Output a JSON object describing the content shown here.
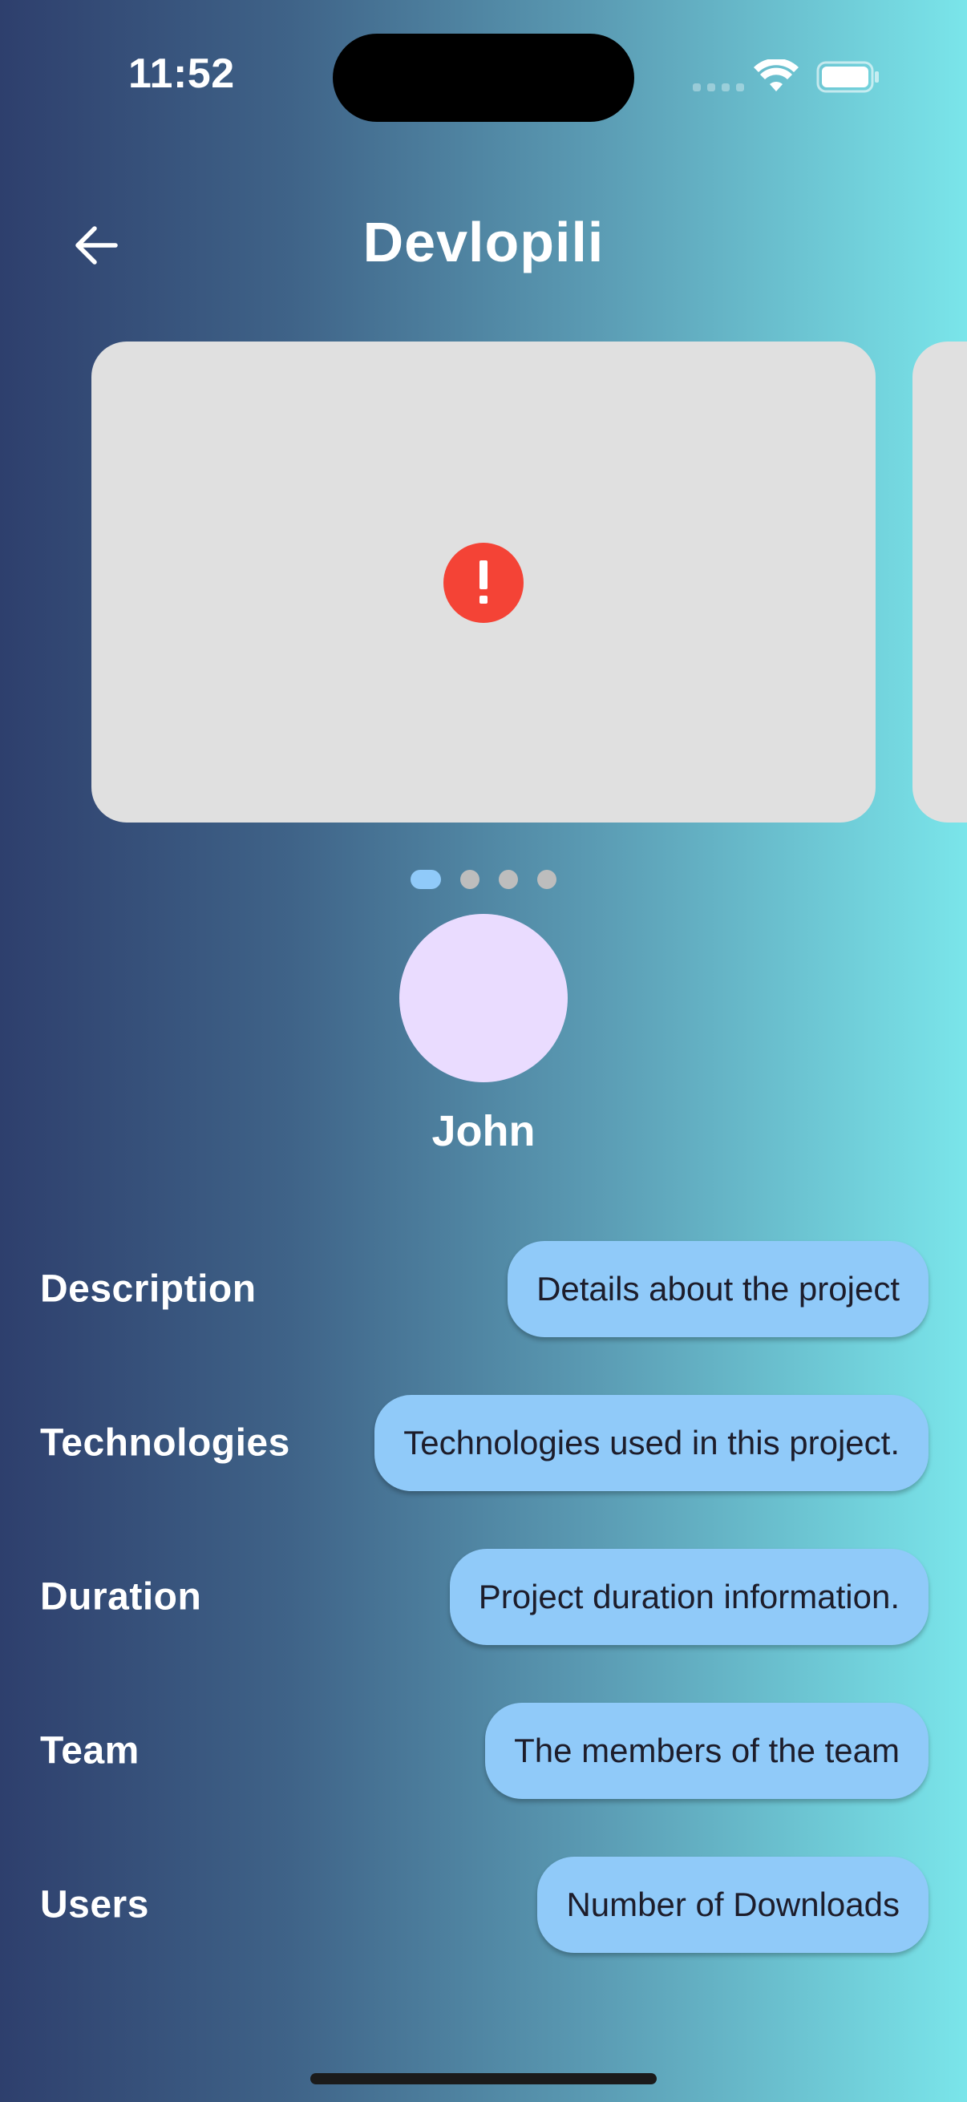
{
  "status_bar": {
    "time": "11:52",
    "icons": [
      "cellular-signal-icon",
      "wifi-icon",
      "battery-icon"
    ]
  },
  "header": {
    "title": "Devlopili",
    "back_icon": "arrow-left-icon"
  },
  "carousel": {
    "current_image_state": "error",
    "error_icon": "error-circle-icon",
    "page_count": 4,
    "active_index": 0
  },
  "profile": {
    "name": "John"
  },
  "details": [
    {
      "label": "Description",
      "value": "Details about the project"
    },
    {
      "label": "Technologies",
      "value": "Technologies used in this project."
    },
    {
      "label": "Duration",
      "value": "Project duration information."
    },
    {
      "label": "Team",
      "value": "The members of the team"
    },
    {
      "label": "Users",
      "value": "Number of Downloads"
    }
  ],
  "colors": {
    "gradient_start": "#2e3f6d",
    "gradient_end": "#7ae5ea",
    "chip_bg": "#90caf9",
    "card_bg": "#e0e0e0",
    "error_red": "#f44336",
    "avatar_bg": "#eadcff",
    "dot_active": "#90caf9",
    "dot_inactive": "#bdbdbd"
  }
}
